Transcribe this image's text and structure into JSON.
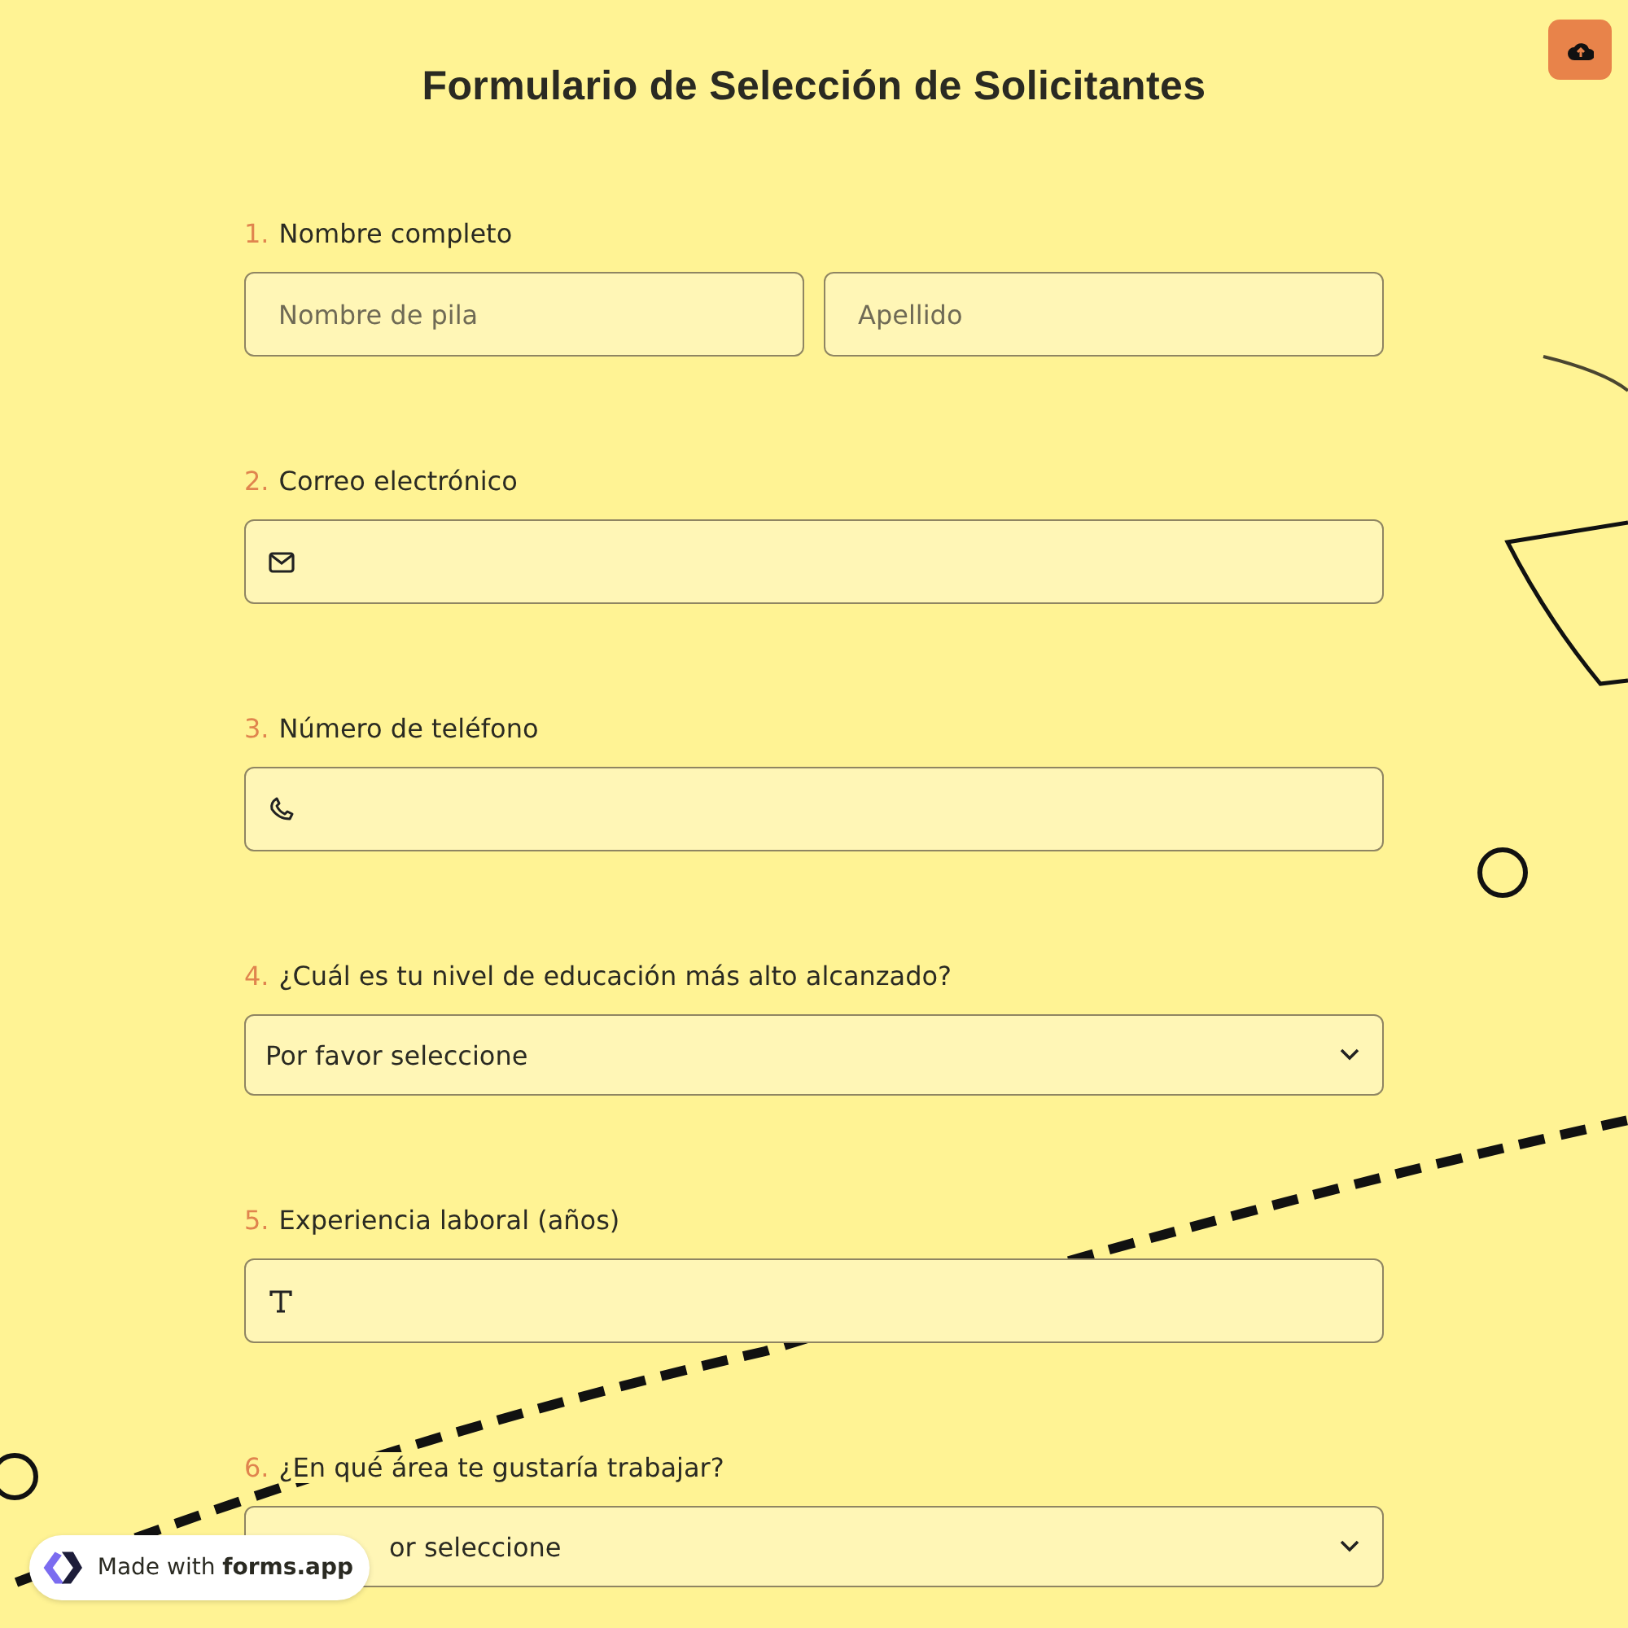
{
  "title": "Formulario de Selección de Solicitantes",
  "questions": [
    {
      "number": "1.",
      "label": "Nombre completo",
      "kind": "name",
      "fields": [
        {
          "placeholder": "Nombre de pila"
        },
        {
          "placeholder": "Apellido"
        }
      ]
    },
    {
      "number": "2.",
      "label": "Correo electrónico",
      "kind": "email"
    },
    {
      "number": "3.",
      "label": "Número de teléfono",
      "kind": "phone"
    },
    {
      "number": "4.",
      "label": "¿Cuál es tu nivel de educación más alto alcanzado?",
      "kind": "select",
      "value": "Por favor seleccione"
    },
    {
      "number": "5.",
      "label": "Experiencia laboral (años)",
      "kind": "text"
    },
    {
      "number": "6.",
      "label": "¿En qué área te gustaría trabajar?",
      "kind": "covered_select",
      "value": "or seleccione"
    }
  ],
  "badge": {
    "text": "Made with **forms.app**"
  }
}
